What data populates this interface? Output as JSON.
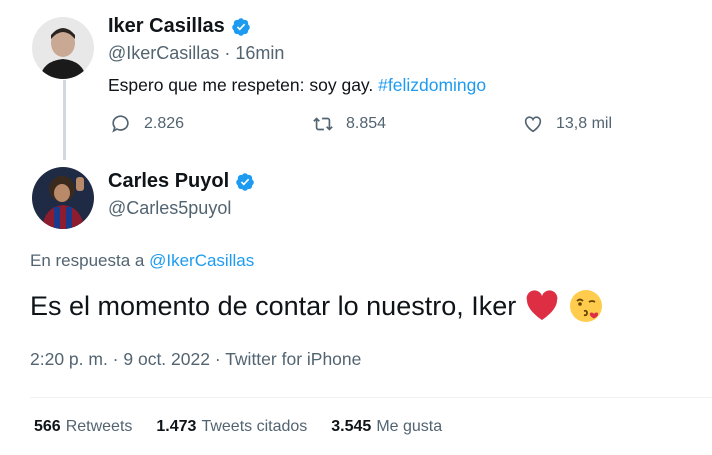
{
  "tweet1": {
    "display_name": "Iker Casillas",
    "handle": "@IkerCasillas",
    "separator": "·",
    "time": "16min",
    "text": "Espero que me respeten: soy gay.",
    "hashtag": "#felizdomingo",
    "reply_count": "2.826",
    "retweet_count": "8.854",
    "like_count": "13,8 mil"
  },
  "tweet2": {
    "display_name": "Carles Puyol",
    "handle": "@Carles5puyol",
    "reply_prefix": "En respuesta a",
    "reply_mention": "@IkerCasillas",
    "text": "Es el momento de contar lo nuestro, Iker",
    "emojis": [
      "red-heart",
      "face-blowing-kiss"
    ],
    "timestamp": "2:20 p. m. · 9 oct. 2022 · Twitter for iPhone",
    "stats": [
      {
        "count": "566",
        "label": "Retweets"
      },
      {
        "count": "1.473",
        "label": "Tweets citados"
      },
      {
        "count": "3.545",
        "label": "Me gusta"
      }
    ]
  },
  "colors": {
    "text": "#0f1419",
    "secondary": "#536471",
    "link": "#1d9bf0",
    "verified": "#1d9bf0",
    "thread_line": "#cfd9de"
  }
}
